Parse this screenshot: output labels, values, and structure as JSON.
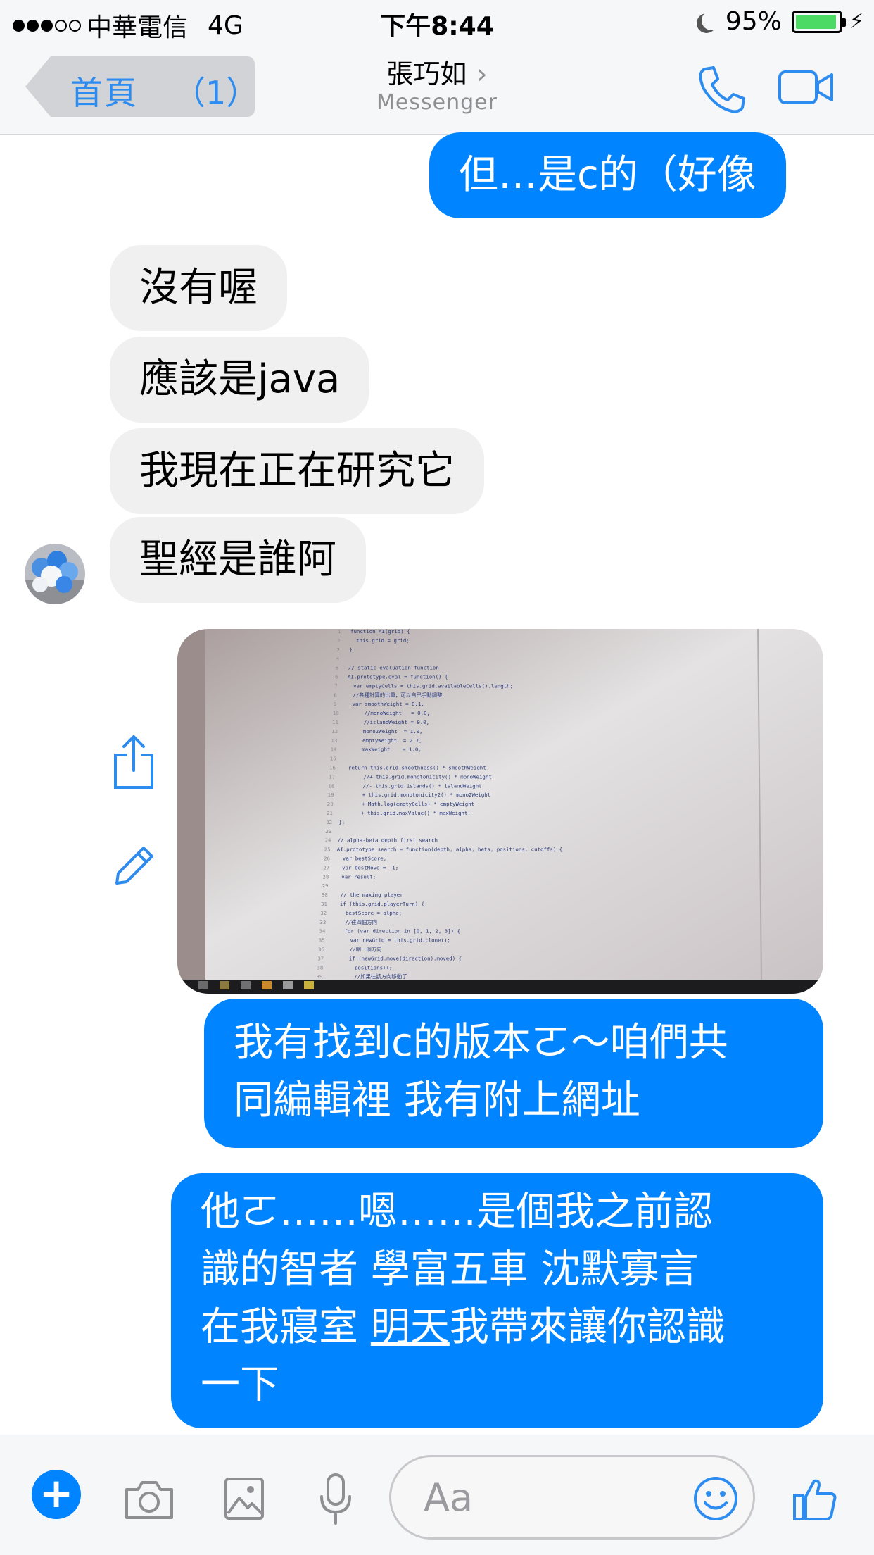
{
  "status_bar": {
    "carrier": "中華電信",
    "network": "4G",
    "time": "下午8:44",
    "battery": "95%",
    "battery_level": 0.95
  },
  "nav": {
    "back_label": "首頁",
    "back_count": "（1）",
    "contact_name": "張巧如",
    "chevron": "›",
    "subtitle": "Messenger"
  },
  "messages": [
    {
      "side": "out",
      "text": "但…是c的（好像"
    },
    {
      "side": "in",
      "text": "沒有喔"
    },
    {
      "side": "in",
      "text": "應該是java"
    },
    {
      "side": "in",
      "text": "我現在正在研究它"
    },
    {
      "side": "in",
      "text": "聖經是誰阿"
    },
    {
      "side": "out",
      "type": "photo"
    },
    {
      "side": "out",
      "lines": [
        "我有找到c的版本ㄛ～咱們共",
        "同編輯裡 我有附上網址"
      ]
    },
    {
      "side": "out",
      "lines": [
        "他ㄛ……嗯……是個我之前認",
        "識的智者 學富五車 沈默寡言",
        "在我寢室 ",
        "明天",
        "我帶來讓你認識",
        "一下"
      ]
    }
  ],
  "photo_code": [
    "function AI(grid) {",
    "  this.grid = grid;",
    "}",
    "",
    "// static evaluation function",
    "AI.prototype.eval = function() {",
    "  var emptyCells = this.grid.availableCells().length;",
    "  //各種計算的比重，可以自己手動調整",
    "  var smoothWeight = 0.1,",
    "      //monoWeight   = 0.0,",
    "      //islandWeight = 0.0,",
    "      mono2Weight  = 1.0,",
    "      emptyWeight  = 2.7,",
    "      maxWeight    = 1.0;",
    "",
    "  return this.grid.smoothness() * smoothWeight",
    "       //+ this.grid.monotonicity() * monoWeight",
    "       //- this.grid.islands() * islandWeight",
    "       + this.grid.monotonicity2() * mono2Weight",
    "       + Math.log(emptyCells) * emptyWeight",
    "       + this.grid.maxValue() * maxWeight;",
    "};",
    "",
    "// alpha-beta depth first search",
    "AI.prototype.search = function(depth, alpha, beta, positions, cutoffs) {",
    "  var bestScore;",
    "  var bestMove = -1;",
    "  var result;",
    "",
    "  // the maxing player",
    "  if (this.grid.playerTurn) {",
    "    bestScore = alpha;",
    "    //往四個方向",
    "    for (var direction in [0, 1, 2, 3]) {",
    "      var newGrid = this.grid.clone();",
    "      //朝一個方向",
    "      if (newGrid.move(direction).moved) {",
    "        positions++;",
    "        //如果往該方向移動了"
  ],
  "composer": {
    "placeholder": "Aa"
  },
  "icons": {
    "back": "back-arrow-icon",
    "call": "phone-icon",
    "video": "video-camera-icon",
    "share": "share-icon",
    "edit": "pencil-icon",
    "plus": "plus-icon",
    "camera": "camera-icon",
    "image": "image-icon",
    "mic": "microphone-icon",
    "emoji": "emoji-icon",
    "like": "thumbs-up-icon"
  },
  "colors": {
    "accent": "#0084ff",
    "outgoing_bubble": "#0084ff",
    "incoming_bubble": "#f1f0f0",
    "battery": "#4cd964"
  }
}
